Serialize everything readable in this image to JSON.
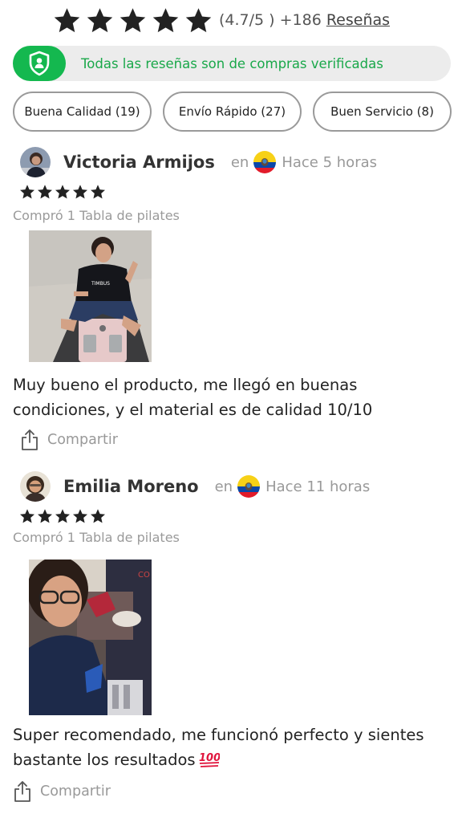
{
  "rating": {
    "value_text": "(4.7/5 )",
    "count_text": "+186",
    "reviews_link": "Reseñas",
    "star_color": "#222222"
  },
  "verified_banner": {
    "text": "Todas las reseñas son de compras verificadas",
    "icon": "shield-user-icon",
    "accent_color": "#14b84f"
  },
  "filter_chips": [
    {
      "label": "Buena Calidad (19)"
    },
    {
      "label": "Envío Rápido (27)"
    },
    {
      "label": "Buen Servicio (8)"
    }
  ],
  "reviews": [
    {
      "name": "Victoria Armijos",
      "in_label": "en",
      "country_flag": "ecuador-flag-icon",
      "time": "Hace 5 horas",
      "stars": 5,
      "purchase": "Compró 1 Tabla de pilates",
      "photo": "woman-sitting-on-pilates-board-photo",
      "text": "Muy bueno el producto, me llegó en buenas condiciones, y el material es de calidad 10/10",
      "share_label": "Compartir"
    },
    {
      "name": "Emilia Moreno",
      "in_label": "en",
      "country_flag": "ecuador-flag-icon",
      "time": "Hace 11 horas",
      "stars": 5,
      "purchase": "Compró 1 Tabla de pilates",
      "photo": "woman-selfie-with-glasses-photo",
      "text": "Super recomendado, me funcionó perfecto y sientes bastante los resultados",
      "text_emoji": "hundred-points-emoji",
      "share_label": "Compartir"
    }
  ]
}
